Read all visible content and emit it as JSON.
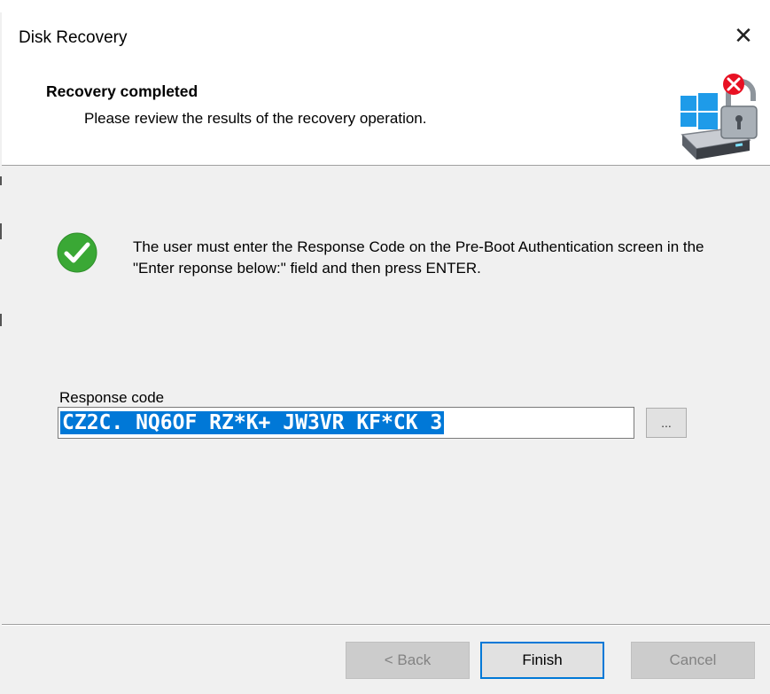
{
  "window": {
    "title": "Disk Recovery",
    "close_symbol": "✕"
  },
  "header": {
    "title": "Recovery completed",
    "subtitle": "Please review the results of the recovery operation.",
    "icon": "disk-encryption-lock-icon"
  },
  "message": {
    "icon": "success-check-icon",
    "text": "The user must enter the Response Code on the Pre-Boot Authentication screen in the \"Enter reponse below:\" field and then press ENTER."
  },
  "response": {
    "label": "Response code",
    "value": "CZ2C. NQ6OF RZ*K+ JW3VR KF*CK 3",
    "browse_label": "..."
  },
  "buttons": {
    "back": "< Back",
    "finish": "Finish",
    "cancel": "Cancel"
  },
  "colors": {
    "accent": "#0078d7",
    "success": "#3aa835",
    "error": "#e81123"
  }
}
